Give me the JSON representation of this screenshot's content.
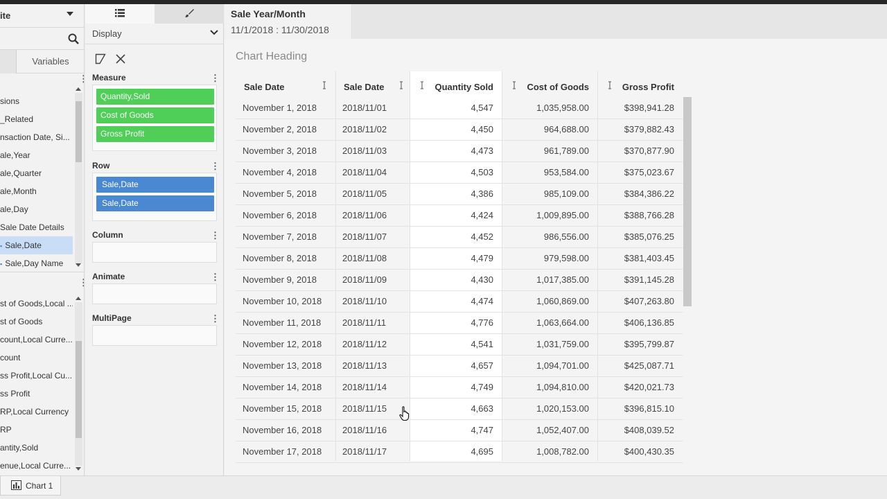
{
  "left_panel": {
    "datasource_name": "ite",
    "tabs": {
      "variables": "Variables"
    },
    "dimensions": [
      {
        "label": "sions",
        "selected": false
      },
      {
        "label": "_Related",
        "selected": false
      },
      {
        "label": "nsaction Date, Si...",
        "selected": false
      },
      {
        "label": "ale,Year",
        "selected": false
      },
      {
        "label": "ale,Quarter",
        "selected": false
      },
      {
        "label": "ale,Month",
        "selected": false
      },
      {
        "label": "ale,Day",
        "selected": false
      },
      {
        "label": "Sale Date Details",
        "selected": false
      },
      {
        "label": "Sale,Date",
        "selected": true
      },
      {
        "label": "Sale,Day Name",
        "selected": false
      }
    ],
    "measures": [
      "st of Goods,Local ...",
      "st of Goods",
      "count,Local Curre...",
      "count",
      "ss Profit,Local Cu...",
      "ss Profit",
      "RP,Local Currency",
      "RP",
      "antity,Sold",
      "enue,Local Curre..."
    ]
  },
  "config_panel": {
    "display_label": "Display",
    "sections": {
      "measure": "Measure",
      "row": "Row",
      "column": "Column",
      "animate": "Animate",
      "multipage": "MultiPage"
    },
    "measure_pills": [
      "Quantity,Sold",
      "Cost of Goods",
      "Gross Profit"
    ],
    "row_pills": [
      "Sale,Date",
      "Sale,Date"
    ]
  },
  "filter": {
    "title": "Sale Year/Month",
    "range": "11/1/2018 : 11/30/2018"
  },
  "chart": {
    "heading": "Chart Heading",
    "columns": [
      "Sale Date",
      "Sale Date",
      "Quantity Sold",
      "Cost of Goods",
      "Gross Profit"
    ],
    "rows": [
      [
        "November 1, 2018",
        "2018/11/01",
        "4,547",
        "1,035,958.00",
        "$398,941.28"
      ],
      [
        "November 2, 2018",
        "2018/11/02",
        "4,450",
        "964,688.00",
        "$379,882.43"
      ],
      [
        "November 3, 2018",
        "2018/11/03",
        "4,473",
        "961,789.00",
        "$370,877.90"
      ],
      [
        "November 4, 2018",
        "2018/11/04",
        "4,503",
        "953,584.00",
        "$375,023.67"
      ],
      [
        "November 5, 2018",
        "2018/11/05",
        "4,386",
        "985,109.00",
        "$384,386.22"
      ],
      [
        "November 6, 2018",
        "2018/11/06",
        "4,424",
        "1,009,895.00",
        "$388,766.28"
      ],
      [
        "November 7, 2018",
        "2018/11/07",
        "4,452",
        "986,556.00",
        "$385,076.25"
      ],
      [
        "November 8, 2018",
        "2018/11/08",
        "4,479",
        "979,598.00",
        "$381,403.45"
      ],
      [
        "November 9, 2018",
        "2018/11/09",
        "4,430",
        "1,017,385.00",
        "$391,145.28"
      ],
      [
        "November 10, 2018",
        "2018/11/10",
        "4,474",
        "1,060,869.00",
        "$407,263.80"
      ],
      [
        "November 11, 2018",
        "2018/11/11",
        "4,776",
        "1,063,664.00",
        "$406,136.85"
      ],
      [
        "November 12, 2018",
        "2018/11/12",
        "4,541",
        "1,031,759.00",
        "$395,799.87"
      ],
      [
        "November 13, 2018",
        "2018/11/13",
        "4,657",
        "1,094,701.00",
        "$425,087.71"
      ],
      [
        "November 14, 2018",
        "2018/11/14",
        "4,749",
        "1,094,810.00",
        "$420,021.73"
      ],
      [
        "November 15, 2018",
        "2018/11/15",
        "4,663",
        "1,020,153.00",
        "$396,815.10"
      ],
      [
        "November 16, 2018",
        "2018/11/16",
        "4,747",
        "1,052,407.00",
        "$408,039.52"
      ],
      [
        "November 17, 2018",
        "2018/11/17",
        "4,695",
        "1,008,782.00",
        "$400,430.35"
      ]
    ]
  },
  "bottom_tabs": [
    "Chart 1"
  ],
  "colors": {
    "measure_pill": "#4fcf57",
    "row_pill": "#4a89d1",
    "selected_item": "#c9def6"
  }
}
